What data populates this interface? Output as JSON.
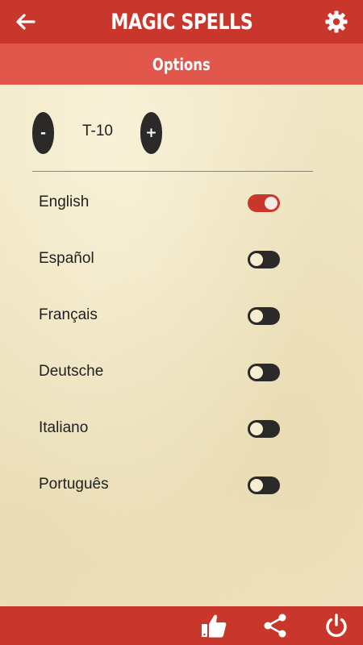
{
  "header": {
    "title": "MAGIC SPELLS",
    "back_icon": "back-arrow-icon",
    "settings_icon": "gear-icon"
  },
  "subheader": {
    "title": "Options"
  },
  "text_size": {
    "decrease_label": "-",
    "value": "T-10",
    "increase_label": "+"
  },
  "languages": [
    {
      "label": "English",
      "enabled": true
    },
    {
      "label": "Español",
      "enabled": false
    },
    {
      "label": "Français",
      "enabled": false
    },
    {
      "label": "Deutsche",
      "enabled": false
    },
    {
      "label": "Italiano",
      "enabled": false
    },
    {
      "label": "Português",
      "enabled": false
    }
  ],
  "footer": {
    "icons": [
      "thumbs-up-icon",
      "share-icon",
      "power-icon"
    ]
  },
  "colors": {
    "primary": "#c9372c",
    "secondary": "#e1574b",
    "dark": "#2b2a28",
    "background": "#f0e6c4"
  }
}
